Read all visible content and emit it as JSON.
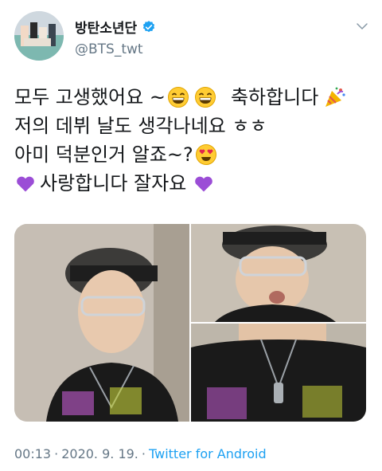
{
  "tweet": {
    "display_name": "방탄소년단",
    "handle": "@BTS_twt",
    "lines": [
      {
        "segments": [
          "모두 고생했어요 ~",
          "",
          "축하합니다"
        ]
      },
      {
        "text": "저의 데뷔 날도 생각나네요 ㅎㅎ"
      },
      {
        "text": "아미 덕분인거 알죠~?"
      },
      {
        "text": "사랑합니다 잘자요"
      }
    ],
    "footer": {
      "time": "00:13",
      "separator": "·",
      "date": "2020. 9. 19.",
      "source": "Twitter for Android"
    }
  },
  "icons": {
    "verified": "verified-badge-icon",
    "chevron": "chevron-down-icon",
    "emoji_grin": "grinning-face-icon",
    "emoji_party": "party-popper-icon",
    "emoji_hearteyes": "heart-eyes-face-icon",
    "emoji_purpleheart": "purple-heart-icon"
  },
  "colors": {
    "text": "#14171a",
    "muted": "#657786",
    "link": "#1da1f2",
    "verified": "#1da1f2",
    "purple_heart": "#9b4dd6"
  }
}
